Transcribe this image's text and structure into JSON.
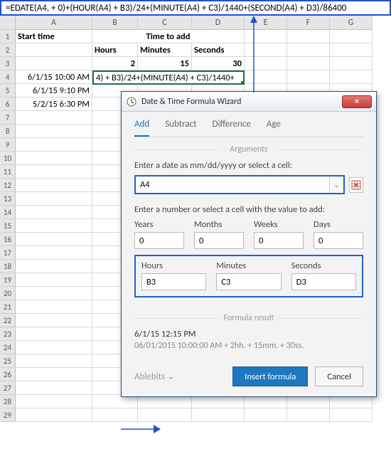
{
  "formula_bar": "=EDATE(A4, + 0)+(HOUR(A4) + B3)/24+(MINUTE(A4) + C3)/1440+(SECOND(A4) + D3)/86400",
  "columns": {
    "A": "A",
    "B": "B",
    "C": "C",
    "D": "D",
    "E": "E",
    "F": "F",
    "G": "G"
  },
  "rows": [
    "1",
    "2",
    "3",
    "4",
    "5",
    "6",
    "7",
    "8",
    "9",
    "10",
    "11",
    "12",
    "13",
    "14",
    "15",
    "16",
    "17",
    "18",
    "19",
    "20",
    "21",
    "22",
    "23",
    "24",
    "25",
    "26",
    "27",
    "28",
    "29"
  ],
  "sheet": {
    "A1": "Start time",
    "BCD1": "Time to add",
    "B2": "Hours",
    "C2": "Minutes",
    "D2": "Seconds",
    "B3": "2",
    "C3": "15",
    "D3": "30",
    "A4": "6/1/15 10:00 AM",
    "B4_overflow": "4) + B3)/24+(MINUTE(A4) + C3)/1440+",
    "A5": "6/1/15 9:10 PM",
    "A6": "5/2/15 6:30 PM"
  },
  "dialog": {
    "title": "Date & Time Formula Wizard",
    "tabs": {
      "add": "Add",
      "subtract": "Subtract",
      "difference": "Difference",
      "age": "Age"
    },
    "section_args": "Arguments",
    "label_date": "Enter a date as mm/dd/yyyy or select a cell:",
    "date_value": "A4",
    "label_num": "Enter a number or select a cell with the value to add:",
    "nums": {
      "years_label": "Years",
      "months_label": "Months",
      "weeks_label": "Weeks",
      "days_label": "Days",
      "years": "0",
      "months": "0",
      "weeks": "0",
      "days": "0",
      "hours_label": "Hours",
      "minutes_label": "Minutes",
      "seconds_label": "Seconds",
      "hours": "B3",
      "minutes": "C3",
      "seconds": "D3"
    },
    "section_result": "Formula result",
    "result_line1": "6/1/15 12:15 PM",
    "result_line2": "06/01/2015 10:00:00 AM + 2hh. + 15mm. + 30ss.",
    "brand": "Ablebits",
    "insert": "Insert formula",
    "cancel": "Cancel",
    "close": "×",
    "chevron": "⌄"
  }
}
